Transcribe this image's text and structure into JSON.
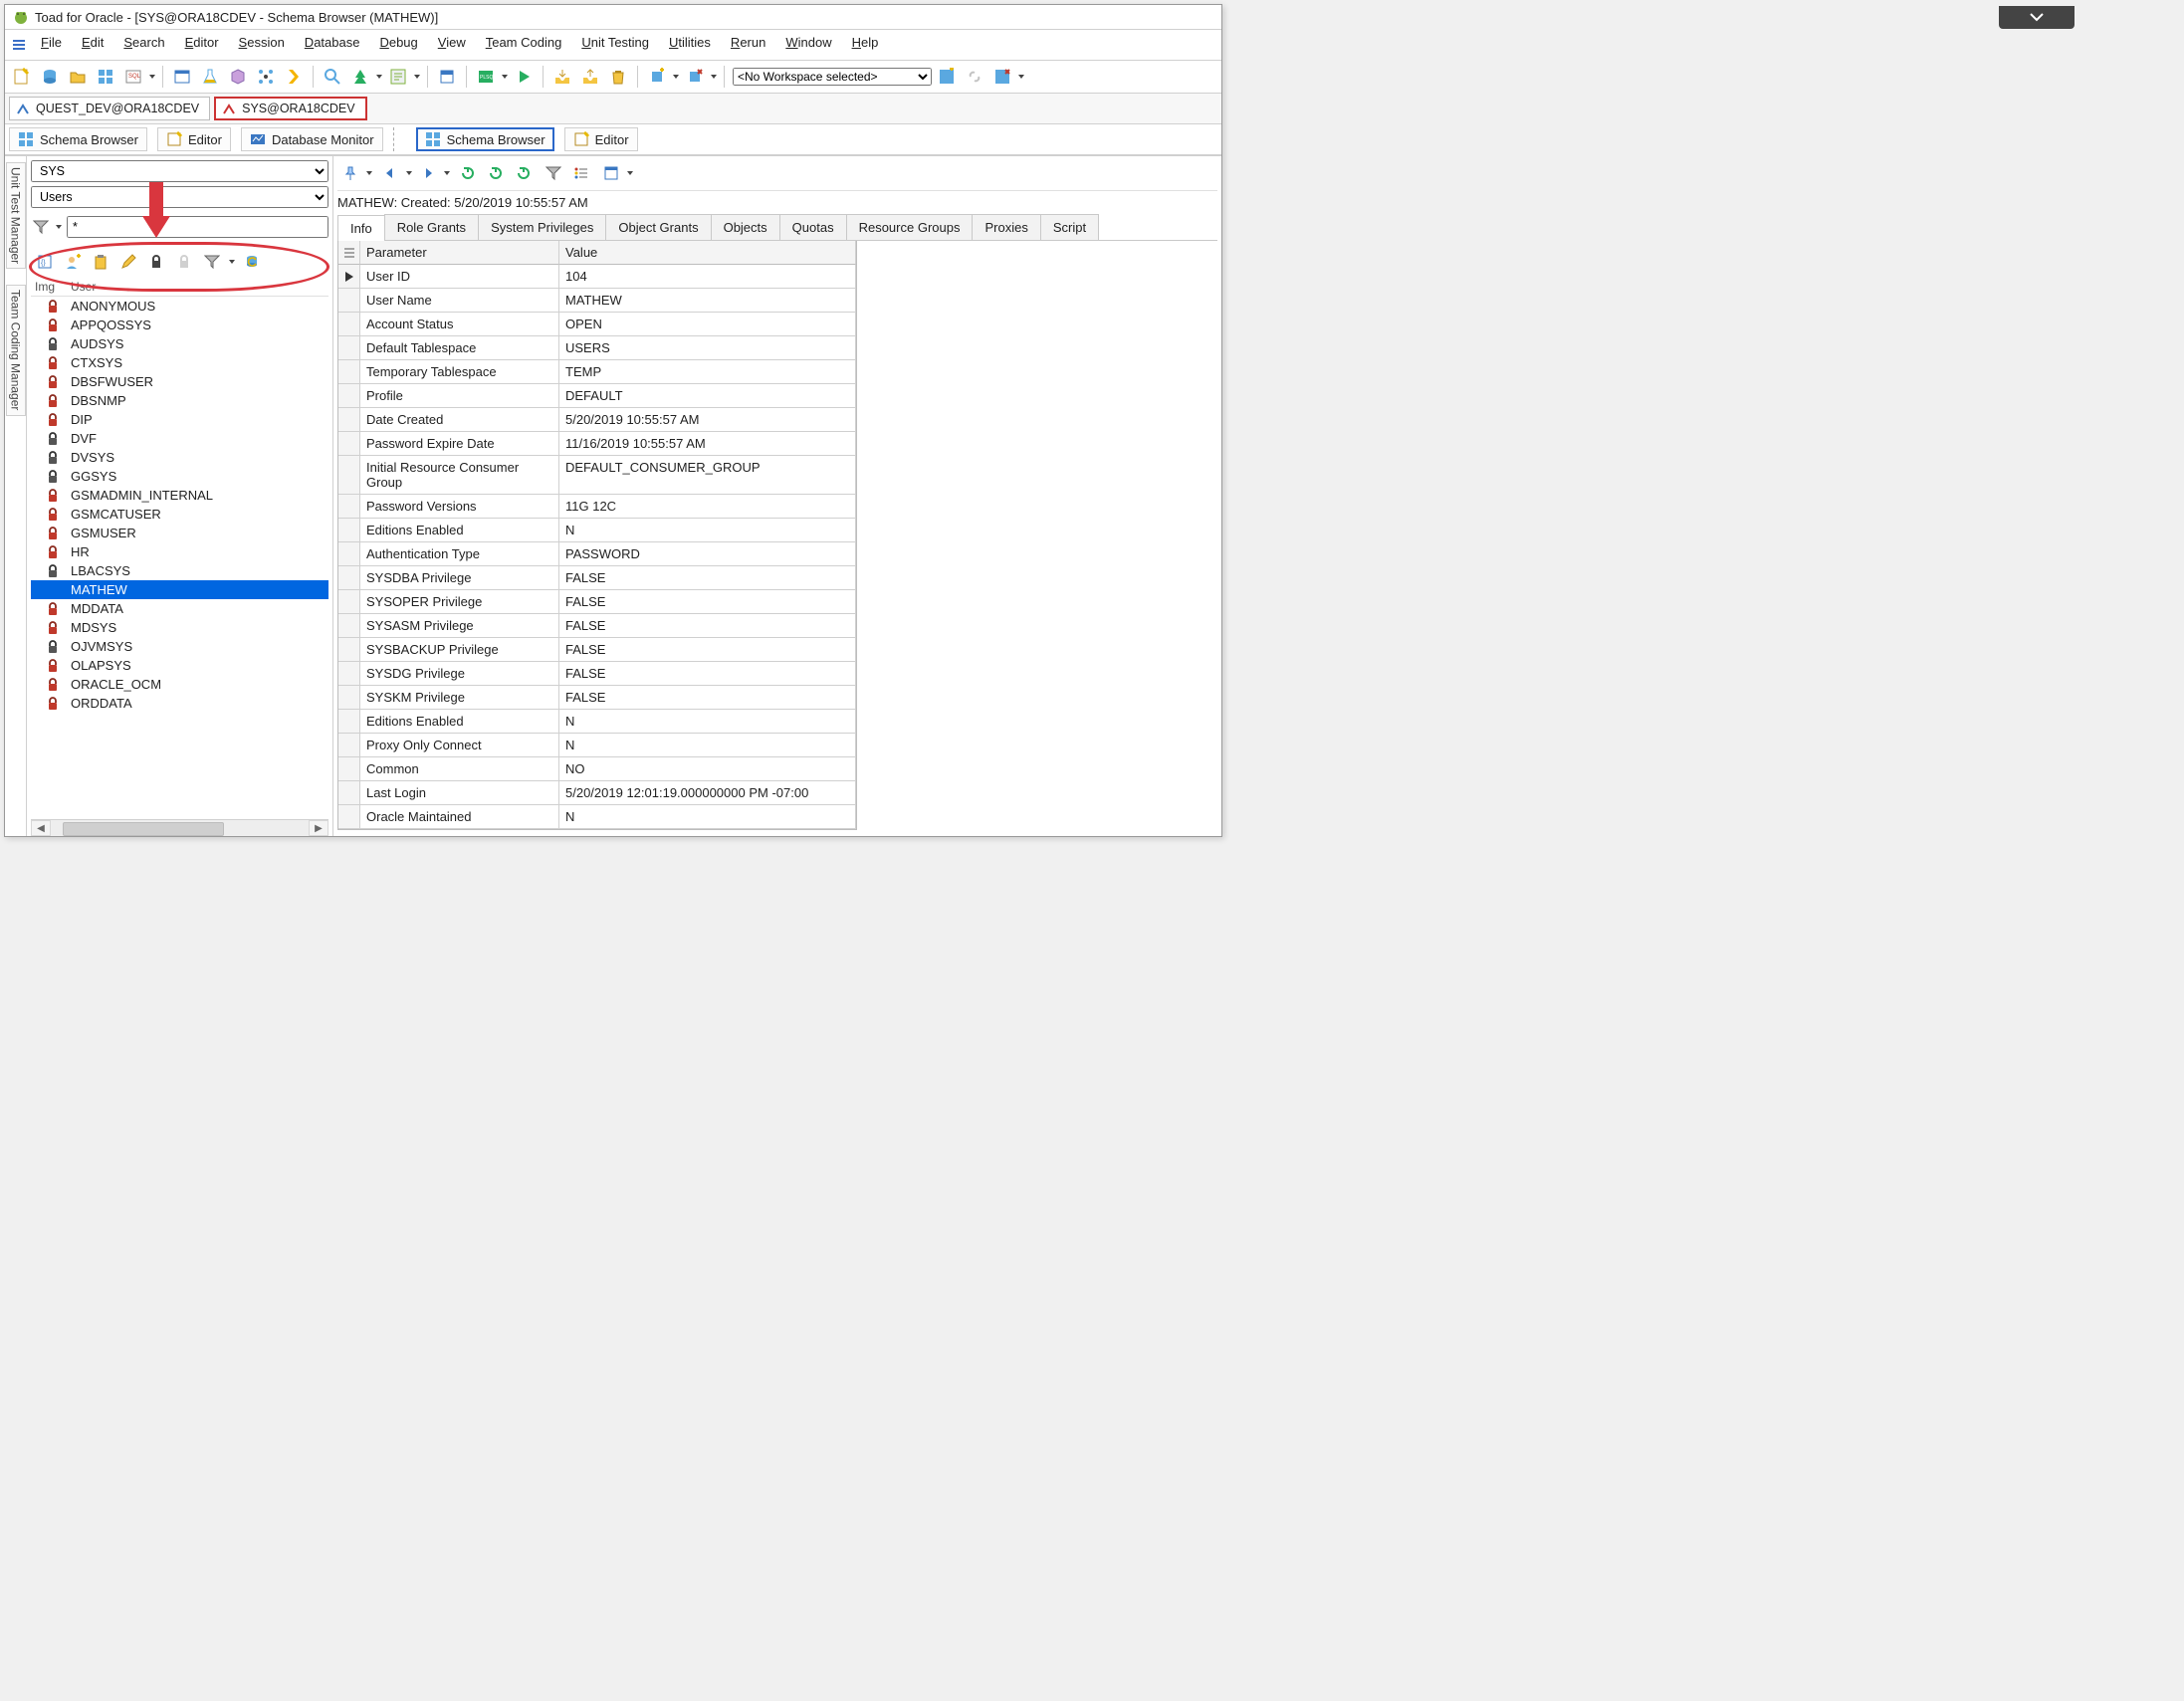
{
  "window_title": "Toad for Oracle - [SYS@ORA18CDEV - Schema Browser (MATHEW)]",
  "menubar": [
    "File",
    "Edit",
    "Search",
    "Editor",
    "Session",
    "Database",
    "Debug",
    "View",
    "Team Coding",
    "Unit Testing",
    "Utilities",
    "Rerun",
    "Window",
    "Help"
  ],
  "workspace_combo": "<No Workspace selected>",
  "connection_tabs": [
    {
      "label": "QUEST_DEV@ORA18CDEV",
      "active": false
    },
    {
      "label": "SYS@ORA18CDEV",
      "active": true
    }
  ],
  "tool_windows_left": [
    {
      "label": "Schema Browser",
      "kind": "schema"
    },
    {
      "label": "Editor",
      "kind": "editor"
    },
    {
      "label": "Database Monitor",
      "kind": "dbmon"
    }
  ],
  "tool_windows_right": [
    {
      "label": "Schema Browser",
      "kind": "schema",
      "active": true
    },
    {
      "label": "Editor",
      "kind": "editor"
    }
  ],
  "left_dock": [
    "Unit Test Manager",
    "Team Coding Manager"
  ],
  "nav": {
    "schema_combo": "SYS",
    "objtype_combo": "Users",
    "filter_value": "*",
    "list_head_img": "Img",
    "list_head_user": "User"
  },
  "users": [
    {
      "icon": "r",
      "name": "ANONYMOUS"
    },
    {
      "icon": "r",
      "name": "APPQOSSYS"
    },
    {
      "icon": "g",
      "name": "AUDSYS"
    },
    {
      "icon": "r",
      "name": "CTXSYS"
    },
    {
      "icon": "r",
      "name": "DBSFWUSER"
    },
    {
      "icon": "r",
      "name": "DBSNMP"
    },
    {
      "icon": "r",
      "name": "DIP"
    },
    {
      "icon": "g",
      "name": "DVF"
    },
    {
      "icon": "g",
      "name": "DVSYS"
    },
    {
      "icon": "g",
      "name": "GGSYS"
    },
    {
      "icon": "r",
      "name": "GSMADMIN_INTERNAL"
    },
    {
      "icon": "r",
      "name": "GSMCATUSER"
    },
    {
      "icon": "r",
      "name": "GSMUSER"
    },
    {
      "icon": "r",
      "name": "HR"
    },
    {
      "icon": "g",
      "name": "LBACSYS"
    },
    {
      "icon": "sel",
      "name": "MATHEW"
    },
    {
      "icon": "r",
      "name": "MDDATA"
    },
    {
      "icon": "r",
      "name": "MDSYS"
    },
    {
      "icon": "g",
      "name": "OJVMSYS"
    },
    {
      "icon": "r",
      "name": "OLAPSYS"
    },
    {
      "icon": "r",
      "name": "ORACLE_OCM"
    },
    {
      "icon": "r",
      "name": "ORDDATA"
    }
  ],
  "detail_status": "MATHEW:  Created: 5/20/2019 10:55:57 AM",
  "detail_tabs": [
    "Info",
    "Role Grants",
    "System Privileges",
    "Object Grants",
    "Objects",
    "Quotas",
    "Resource Groups",
    "Proxies",
    "Script"
  ],
  "info_head": {
    "param": "Parameter",
    "value": "Value"
  },
  "info": [
    {
      "p": "User ID",
      "v": "104",
      "cur": true
    },
    {
      "p": "User Name",
      "v": "MATHEW"
    },
    {
      "p": "Account Status",
      "v": "OPEN"
    },
    {
      "p": "Default Tablespace",
      "v": "USERS"
    },
    {
      "p": "Temporary Tablespace",
      "v": "TEMP"
    },
    {
      "p": "Profile",
      "v": "DEFAULT"
    },
    {
      "p": "Date Created",
      "v": "5/20/2019 10:55:57 AM"
    },
    {
      "p": "Password Expire Date",
      "v": "11/16/2019 10:55:57 AM"
    },
    {
      "p": "Initial Resource Consumer Group",
      "v": "DEFAULT_CONSUMER_GROUP"
    },
    {
      "p": "Password Versions",
      "v": "11G 12C"
    },
    {
      "p": "Editions Enabled",
      "v": "N"
    },
    {
      "p": "Authentication Type",
      "v": "PASSWORD"
    },
    {
      "p": "SYSDBA Privilege",
      "v": "FALSE"
    },
    {
      "p": "SYSOPER Privilege",
      "v": "FALSE"
    },
    {
      "p": "SYSASM Privilege",
      "v": "FALSE"
    },
    {
      "p": "SYSBACKUP Privilege",
      "v": "FALSE"
    },
    {
      "p": "SYSDG Privilege",
      "v": "FALSE"
    },
    {
      "p": "SYSKM Privilege",
      "v": "FALSE"
    },
    {
      "p": "Editions Enabled",
      "v": "N"
    },
    {
      "p": "Proxy Only Connect",
      "v": "N"
    },
    {
      "p": "Common",
      "v": "NO"
    },
    {
      "p": "Last Login",
      "v": "5/20/2019 12:01:19.000000000 PM -07:00"
    },
    {
      "p": "Oracle Maintained",
      "v": "N"
    }
  ]
}
